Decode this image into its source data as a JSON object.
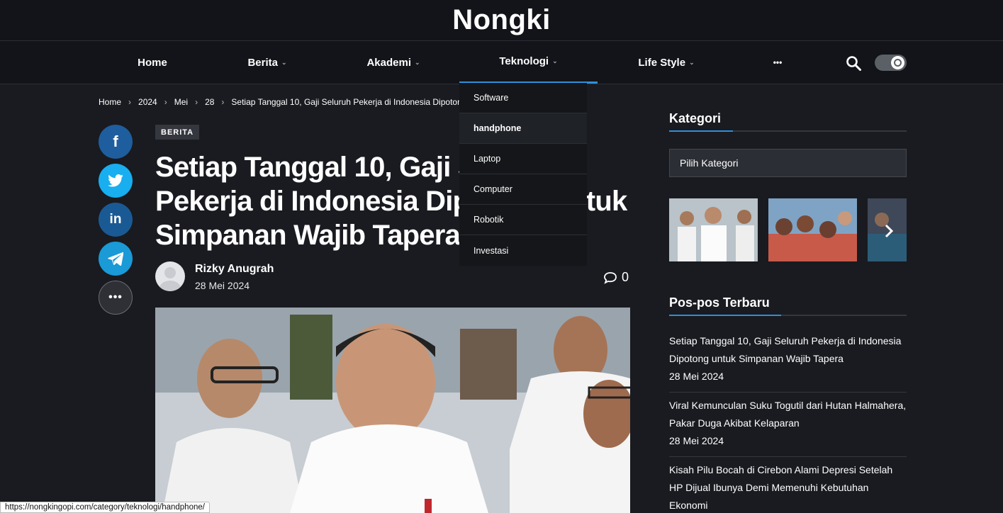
{
  "site": {
    "title": "Nongki"
  },
  "nav": {
    "items": [
      {
        "label": "Home",
        "has_dropdown": false
      },
      {
        "label": "Berita",
        "has_dropdown": true
      },
      {
        "label": "Akademi",
        "has_dropdown": true
      },
      {
        "label": "Teknologi",
        "has_dropdown": true,
        "active": true
      },
      {
        "label": "Life Style",
        "has_dropdown": true
      },
      {
        "label": "•••",
        "has_dropdown": false
      }
    ],
    "search_icon": "search-icon",
    "theme_toggle_icon": "dark-mode-toggle"
  },
  "dropdown": {
    "items": [
      "Software",
      "handphone",
      "Laptop",
      "Computer",
      "Robotik",
      "Investasi"
    ],
    "hovered": "handphone"
  },
  "breadcrumb": [
    "Home",
    "2024",
    "Mei",
    "28",
    "Setiap Tanggal 10, Gaji Seluruh Pekerja di Indonesia Dipotong"
  ],
  "share": {
    "buttons": [
      {
        "name": "facebook-share-button",
        "icon": "facebook-icon",
        "glyph": "f"
      },
      {
        "name": "twitter-share-button",
        "icon": "twitter-icon",
        "glyph": ""
      },
      {
        "name": "linkedin-share-button",
        "icon": "linkedin-icon",
        "glyph": "in"
      },
      {
        "name": "telegram-share-button",
        "icon": "telegram-icon",
        "glyph": ""
      },
      {
        "name": "more-share-button",
        "icon": "more-icon",
        "glyph": "•••"
      }
    ]
  },
  "article": {
    "category": "BERITA",
    "title": "Setiap Tanggal 10, Gaji Seluruh Pekerja di Indonesia Dipotong untuk Simpanan Wajib Tapera",
    "author": "Rizky Anugrah",
    "date": "28 Mei 2024",
    "comment_count": "0"
  },
  "sidebar": {
    "category_widget": {
      "title": "Kategori",
      "select_value": "Pilih Kategori"
    },
    "recent_widget": {
      "title": "Pos-pos Terbaru",
      "posts": [
        {
          "title": "Setiap Tanggal 10, Gaji Seluruh Pekerja di Indonesia Dipotong untuk Simpanan Wajib Tapera",
          "date": "28 Mei 2024"
        },
        {
          "title": "Viral Kemunculan Suku Togutil dari Hutan Halmahera, Pakar Duga Akibat Kelaparan",
          "date": "28 Mei 2024"
        },
        {
          "title": "Kisah Pilu Bocah di Cirebon Alami Depresi Setelah HP Dijual Ibunya Demi Memenuhi Kebutuhan Ekonomi",
          "date": ""
        }
      ]
    }
  },
  "statusbar": {
    "url": "https://nongkingopi.com/category/teknologi/handphone/"
  },
  "colors": {
    "accent": "#2f8fd8",
    "background": "#191b20",
    "header": "#121419"
  }
}
